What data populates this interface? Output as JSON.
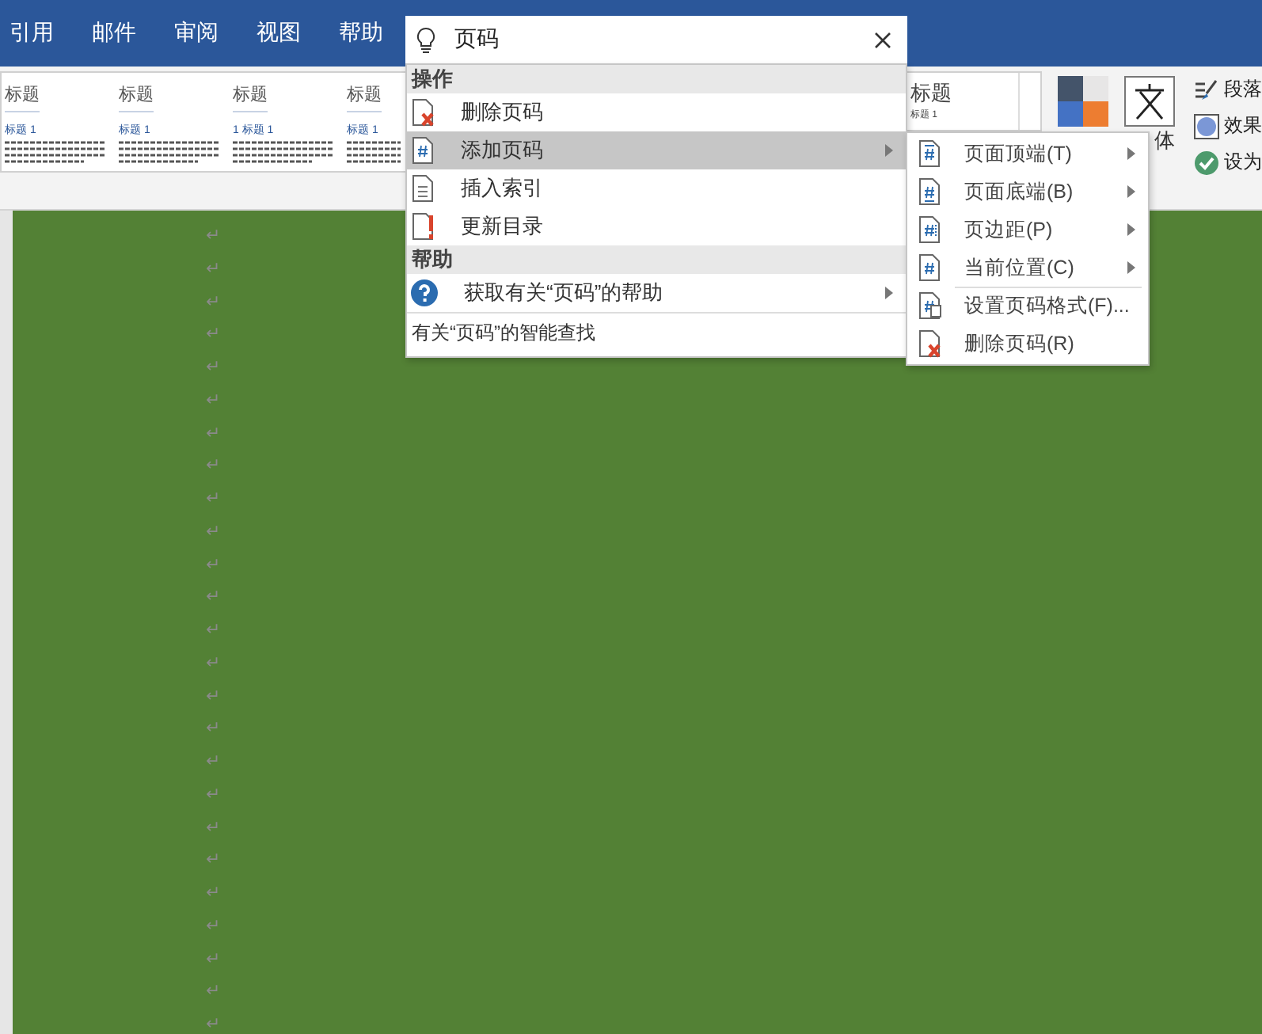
{
  "ribbon_tabs": [
    "引用",
    "邮件",
    "审阅",
    "视图",
    "帮助"
  ],
  "style_gallery": [
    {
      "title": "标题",
      "subtitle": "标题 1"
    },
    {
      "title": "标题",
      "subtitle": "标题 1"
    },
    {
      "title": "标题",
      "subtitle": "1  标题 1"
    },
    {
      "title": "标题",
      "subtitle": "标题 1"
    }
  ],
  "style_gallery_right": {
    "title": "标题",
    "subtitle": "标题 1"
  },
  "design_group": {
    "font_label": "体",
    "side_buttons": [
      "段落",
      "效果",
      "设为"
    ]
  },
  "search": {
    "value": "页码"
  },
  "search_menu": {
    "sections": [
      {
        "header": "操作",
        "items": [
          {
            "label": "删除页码",
            "has_submenu": false,
            "selected": false
          },
          {
            "label": "添加页码",
            "has_submenu": true,
            "selected": true
          },
          {
            "label": "插入索引",
            "has_submenu": false,
            "selected": false
          },
          {
            "label": "更新目录",
            "has_submenu": false,
            "selected": false
          }
        ]
      },
      {
        "header": "帮助",
        "items": [
          {
            "label": "获取有关“页码”的帮助",
            "has_submenu": true,
            "selected": false
          }
        ]
      }
    ],
    "footer": "有关“页码”的智能查找"
  },
  "submenu": {
    "items": [
      {
        "label": "页面顶端(T)",
        "has_submenu": true,
        "divider_before": false
      },
      {
        "label": "页面底端(B)",
        "has_submenu": true,
        "divider_before": false
      },
      {
        "label": "页边距(P)",
        "has_submenu": true,
        "divider_before": false
      },
      {
        "label": "当前位置(C)",
        "has_submenu": true,
        "divider_before": false
      },
      {
        "label": "设置页码格式(F)...",
        "has_submenu": false,
        "divider_before": true
      },
      {
        "label": "删除页码(R)",
        "has_submenu": false,
        "divider_before": false
      }
    ]
  },
  "paragraph_marks": [
    "↵",
    "↵",
    "↵",
    "↵",
    "↵",
    "↵",
    "↵",
    "↵",
    "↵",
    "↵",
    "↵",
    "↵",
    "↵",
    "↵",
    "↵",
    "↵",
    "↵",
    "↵",
    "↵",
    "↵",
    "↵",
    "↵",
    "↵",
    "↵",
    "↵"
  ]
}
